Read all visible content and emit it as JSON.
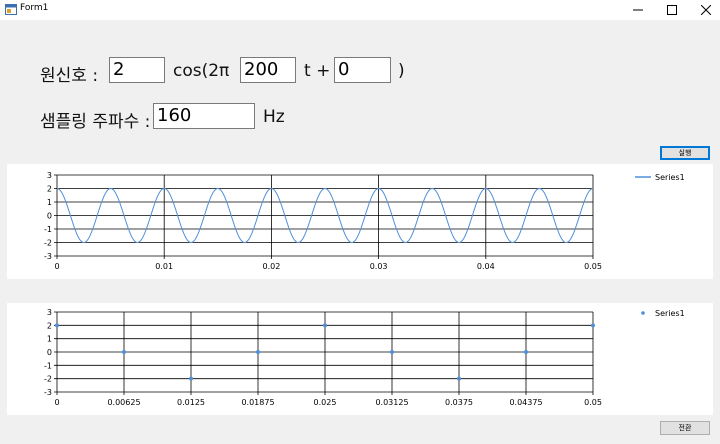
{
  "window": {
    "title": "Form1"
  },
  "signal": {
    "label": "원신호 :",
    "amplitude": "2",
    "cos_label": "cos(2π",
    "frequency": "200",
    "t_label": "t +",
    "phase": "0",
    "close_paren": ")"
  },
  "sampling": {
    "label": "샘플링 주파수 :",
    "frequency": "160",
    "unit": "Hz"
  },
  "buttons": {
    "run": "실행",
    "convert": "전환"
  },
  "chart_data": [
    {
      "type": "line",
      "series": [
        {
          "name": "Series1",
          "amplitude": 2,
          "frequency": 200,
          "phase": 0,
          "color": "#4f8fd8"
        }
      ],
      "xlim": [
        0,
        0.05
      ],
      "ylim": [
        -3,
        3
      ],
      "x_ticks": [
        "0",
        "0.01",
        "0.02",
        "0.03",
        "0.04",
        "0.05"
      ],
      "x_tick_values": [
        0,
        0.01,
        0.02,
        0.03,
        0.04,
        0.05
      ],
      "y_ticks": [
        "3",
        "2",
        "1",
        "0",
        "-1",
        "-2",
        "-3"
      ],
      "y_tick_values": [
        3,
        2,
        1,
        0,
        -1,
        -2,
        -3
      ],
      "grid": true,
      "legend": "top-right"
    },
    {
      "type": "scatter",
      "series": [
        {
          "name": "Series1",
          "color": "#4f8fd8",
          "x": [
            0,
            0.00625,
            0.0125,
            0.01875,
            0.025,
            0.03125,
            0.0375,
            0.04375,
            0.05
          ],
          "y": [
            2,
            0,
            -2,
            0,
            2,
            0,
            -2,
            0,
            2
          ]
        }
      ],
      "xlim": [
        0,
        0.05
      ],
      "ylim": [
        -3,
        3
      ],
      "x_ticks": [
        "0",
        "0.00625",
        "0.0125",
        "0.01875",
        "0.025",
        "0.03125",
        "0.0375",
        "0.04375",
        "0.05"
      ],
      "x_tick_values": [
        0,
        0.00625,
        0.0125,
        0.01875,
        0.025,
        0.03125,
        0.0375,
        0.04375,
        0.05
      ],
      "y_ticks": [
        "3",
        "2",
        "1",
        "0",
        "-1",
        "-2",
        "-3"
      ],
      "y_tick_values": [
        3,
        2,
        1,
        0,
        -1,
        -2,
        -3
      ],
      "grid": true,
      "legend": "top-right"
    }
  ]
}
